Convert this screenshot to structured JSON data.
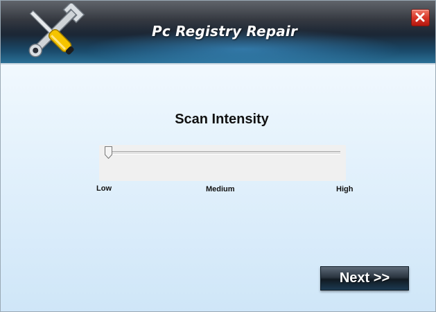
{
  "window": {
    "title": "Pc Registry Repair",
    "close_icon": "close-x-icon",
    "logo_icon": "wrench-screwdriver-icon"
  },
  "scan": {
    "title": "Scan Intensity",
    "slider": {
      "value": 0,
      "min": 0,
      "max": 1
    },
    "labels": {
      "low": "Low",
      "medium": "Medium",
      "high": "High"
    }
  },
  "footer": {
    "next_label": "Next >>"
  },
  "colors": {
    "header_dark": "#1b2736",
    "header_accent": "#2a6f96",
    "body_bg_bottom": "#cfe6f8",
    "close_red": "#d8372a"
  }
}
